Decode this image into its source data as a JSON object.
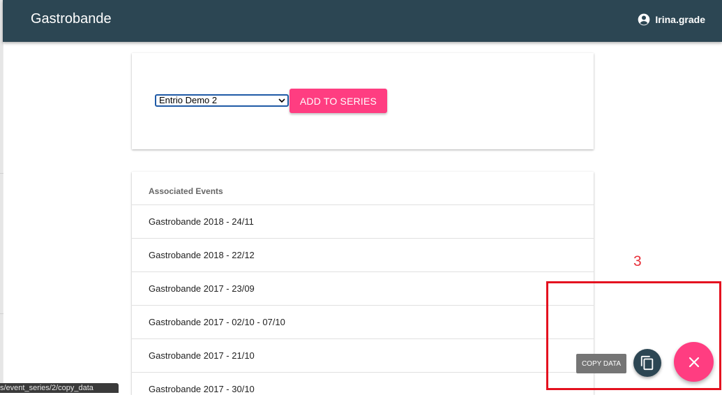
{
  "header": {
    "title": "Gastrobande",
    "username": "Irina.grade",
    "user_icon": "account-circle-icon"
  },
  "form": {
    "selected_option": "Entrio Demo 2",
    "add_button_label": "ADD TO SERIES"
  },
  "events": {
    "header": "Associated Events",
    "items": [
      "Gastrobande 2018 - 24/11",
      "Gastrobande 2018 - 22/12",
      "Gastrobande 2017 - 23/09",
      "Gastrobande 2017 - 02/10 - 07/10",
      "Gastrobande 2017 - 21/10",
      "Gastrobande 2017 - 30/10"
    ]
  },
  "annotation": {
    "number": "3"
  },
  "fab": {
    "tooltip": "COPY DATA",
    "copy_icon": "copy-icon",
    "close_icon": "close-icon"
  },
  "statusbar": {
    "url": "s/event_series/2/copy_data"
  },
  "colors": {
    "appbar": "#2c4653",
    "accent": "#ff3d81",
    "annotation": "#e4111f"
  }
}
